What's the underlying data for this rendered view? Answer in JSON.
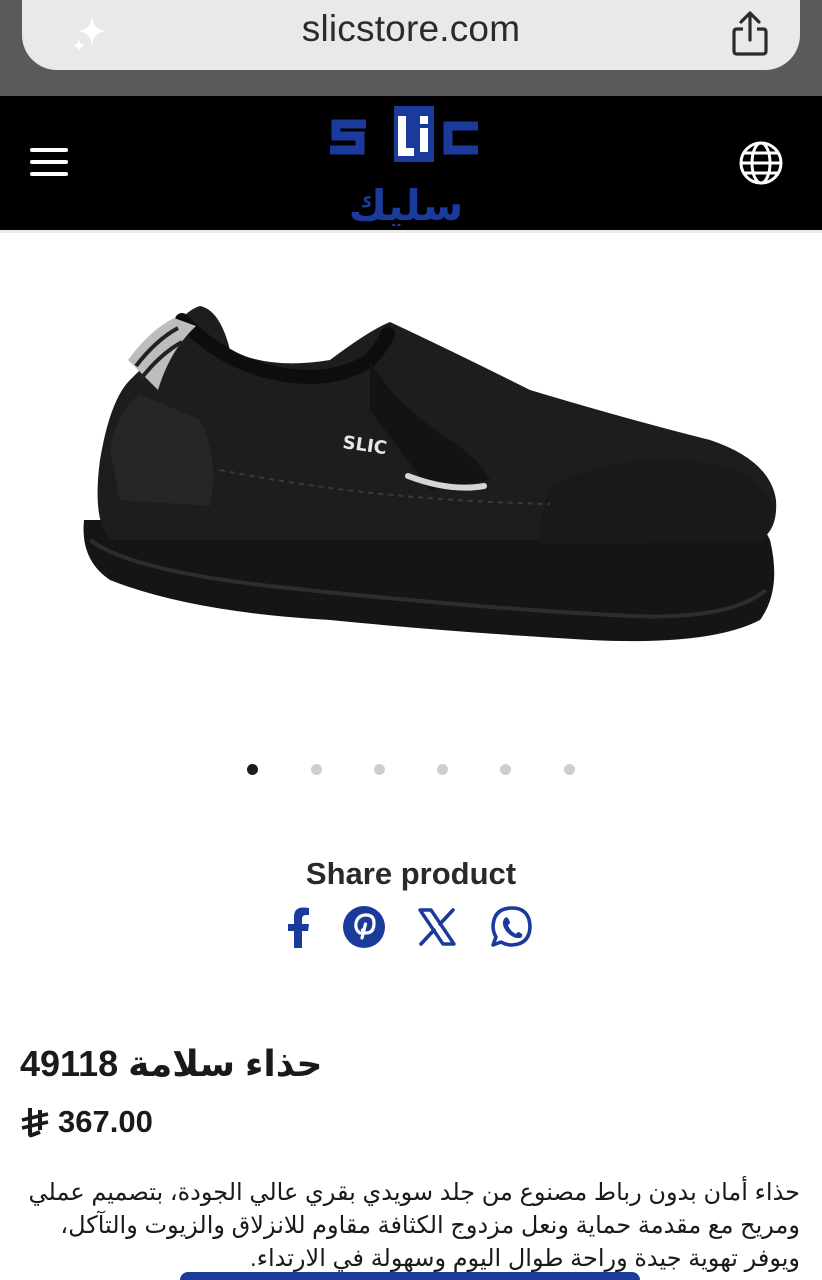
{
  "browser": {
    "url": "slicstore.com"
  },
  "header": {
    "logo_latin": "sLic",
    "logo_arabic": "سليك",
    "brand_color": "#1a3a9c"
  },
  "gallery": {
    "image_count": 6,
    "active_index": 0,
    "shoe_brand_text": "SLIC"
  },
  "share": {
    "title": "Share product",
    "icons": [
      "facebook-icon",
      "pinterest-icon",
      "x-icon",
      "whatsapp-icon"
    ],
    "icon_color": "#1a3a9c"
  },
  "product": {
    "title": "حذاء سلامة 49118",
    "price": "367.00",
    "currency_icon": "saudi-riyal-icon",
    "description": "حذاء أمان بدون رباط مصنوع من جلد سويدي بقري عالي الجودة، بتصميم عملي ومريح مع مقدمة حماية ونعل مزدوج الكثافة مقاوم للانزلاق والزيوت والتآكل، ويوفر تهوية جيدة وراحة طوال اليوم وسهولة في الارتداء."
  }
}
